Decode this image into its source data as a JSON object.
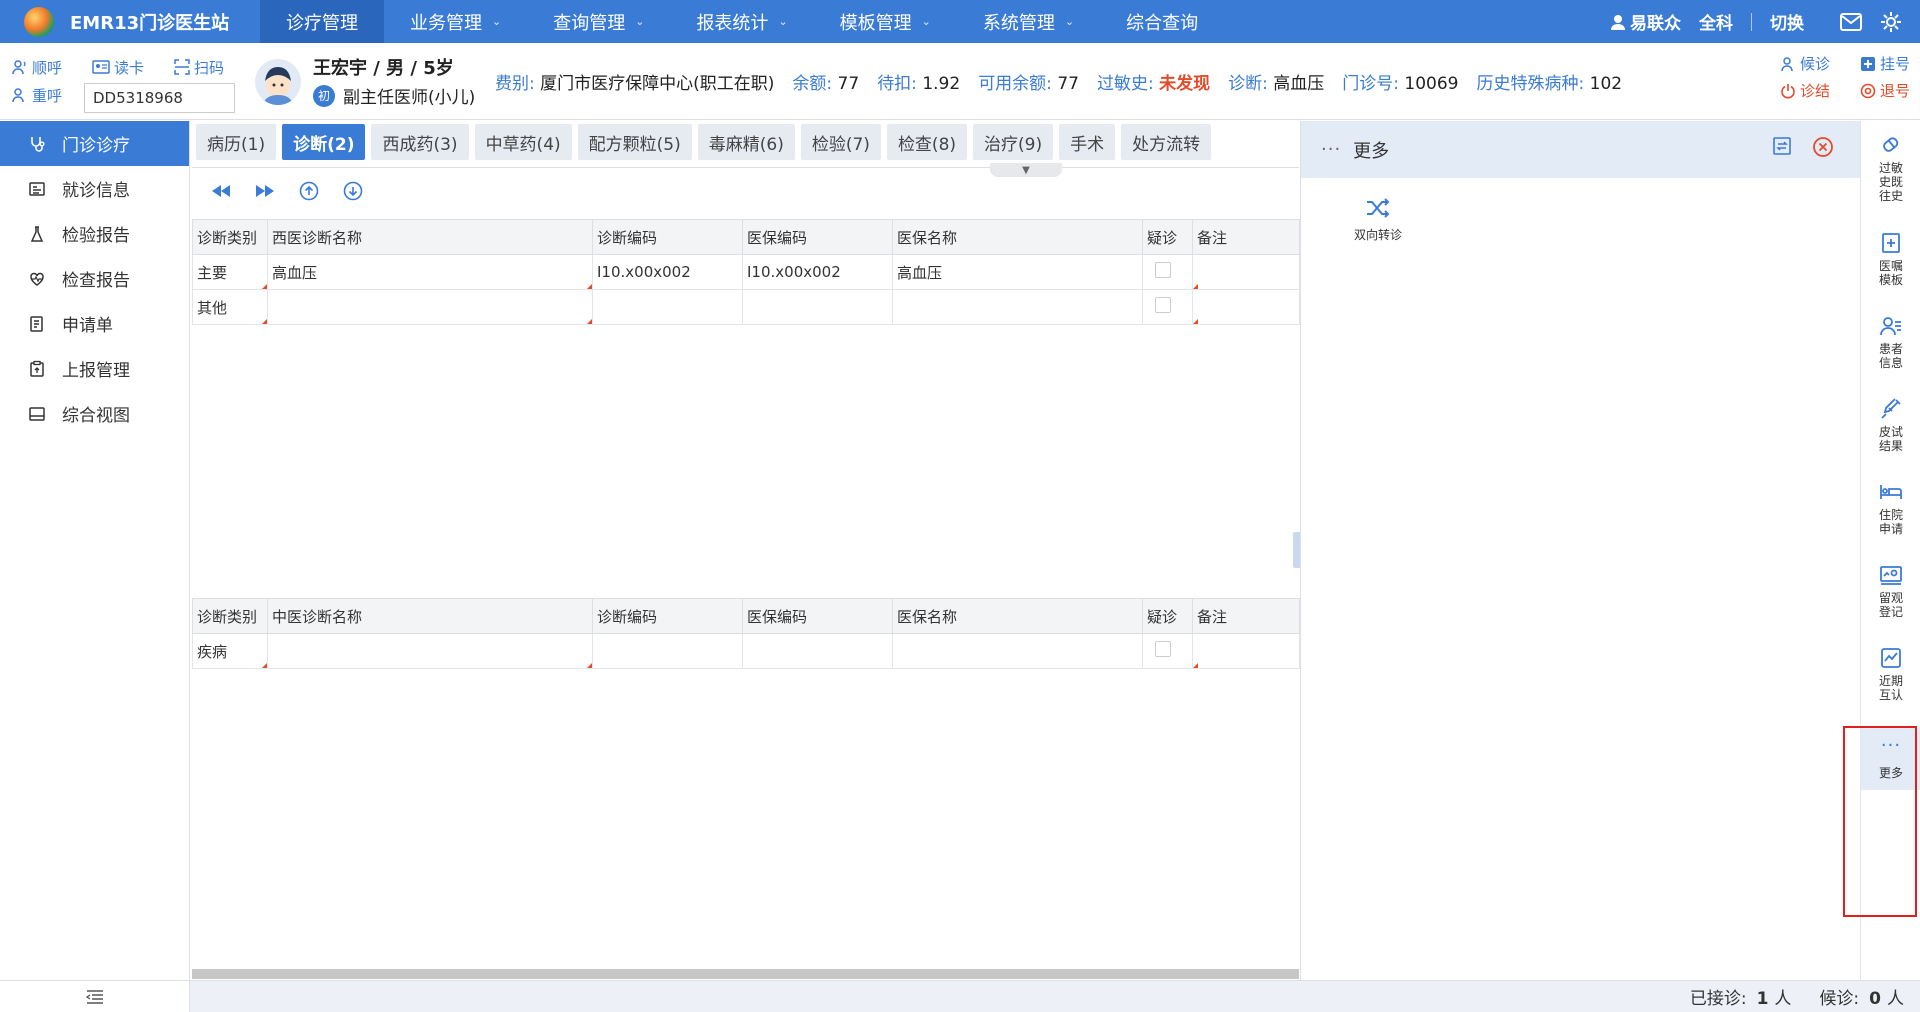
{
  "app": {
    "title": "EMR13门诊医生站"
  },
  "nav": [
    {
      "label": "诊疗管理",
      "active": true,
      "dropdown": false
    },
    {
      "label": "业务管理",
      "active": false,
      "dropdown": true
    },
    {
      "label": "查询管理",
      "active": false,
      "dropdown": true
    },
    {
      "label": "报表统计",
      "active": false,
      "dropdown": true
    },
    {
      "label": "模板管理",
      "active": false,
      "dropdown": true
    },
    {
      "label": "系统管理",
      "active": false,
      "dropdown": true
    },
    {
      "label": "综合查询",
      "active": false,
      "dropdown": false
    }
  ],
  "user": {
    "name": "易联众",
    "dept": "全科",
    "switch_label": "切换"
  },
  "quick_actions": [
    {
      "label": "顺呼",
      "icon": "call-icon"
    },
    {
      "label": "读卡",
      "icon": "card-icon"
    },
    {
      "label": "扫码",
      "icon": "scan-icon"
    },
    {
      "label": "重呼",
      "icon": "recall-icon"
    }
  ],
  "card_number": "DD5318968",
  "patient": {
    "name_line": "王宏宇 / 男 / 5岁",
    "visit_badge": "初",
    "doctor": "副主任医师(小儿)",
    "fields": [
      {
        "label": "费别:",
        "value": "厦门市医疗保障中心(职工在职)",
        "warn": false
      },
      {
        "label": "余额:",
        "value": "77",
        "warn": false
      },
      {
        "label": "待扣:",
        "value": "1.92",
        "warn": false
      },
      {
        "label": "可用余额:",
        "value": "77",
        "warn": false
      },
      {
        "label": "过敏史:",
        "value": "未发现",
        "warn": true
      },
      {
        "label": "诊断:",
        "value": "高血压",
        "warn": false
      },
      {
        "label": "门诊号:",
        "value": "10069",
        "warn": false
      },
      {
        "label": "历史特殊病种:",
        "value": "102",
        "warn": false
      }
    ]
  },
  "right_actions": [
    {
      "label": "候诊",
      "red": false
    },
    {
      "label": "挂号",
      "red": false
    },
    {
      "label": "诊结",
      "red": true
    },
    {
      "label": "退号",
      "red": true
    }
  ],
  "sidebar": [
    {
      "label": "门诊诊疗",
      "active": true,
      "icon": "stethoscope-icon"
    },
    {
      "label": "就诊信息",
      "active": false,
      "icon": "id-card-icon"
    },
    {
      "label": "检验报告",
      "active": false,
      "icon": "flask-icon"
    },
    {
      "label": "检查报告",
      "active": false,
      "icon": "heart-icon"
    },
    {
      "label": "申请单",
      "active": false,
      "icon": "form-icon"
    },
    {
      "label": "上报管理",
      "active": false,
      "icon": "clipboard-icon"
    },
    {
      "label": "综合视图",
      "active": false,
      "icon": "panel-icon"
    }
  ],
  "tabs": [
    {
      "label": "病历(1)",
      "active": false
    },
    {
      "label": "诊断(2)",
      "active": true
    },
    {
      "label": "西成药(3)",
      "active": false
    },
    {
      "label": "中草药(4)",
      "active": false
    },
    {
      "label": "配方颗粒(5)",
      "active": false
    },
    {
      "label": "毒麻精(6)",
      "active": false
    },
    {
      "label": "检验(7)",
      "active": false
    },
    {
      "label": "检查(8)",
      "active": false
    },
    {
      "label": "治疗(9)",
      "active": false
    },
    {
      "label": "手术",
      "active": false
    },
    {
      "label": "处方流转",
      "active": false
    }
  ],
  "western_table": {
    "headers": [
      "诊断类别",
      "西医诊断名称",
      "诊断编码",
      "医保编码",
      "医保名称",
      "疑诊",
      "备注"
    ],
    "rows": [
      [
        "主要",
        "高血压",
        "I10.x00x002",
        "I10.x00x002",
        "高血压",
        "",
        ""
      ],
      [
        "其他",
        "",
        "",
        "",
        "",
        "",
        ""
      ]
    ]
  },
  "chinese_table": {
    "headers": [
      "诊断类别",
      "中医诊断名称",
      "诊断编码",
      "医保编码",
      "医保名称",
      "疑诊",
      "备注"
    ],
    "rows": [
      [
        "疾病",
        "",
        "",
        "",
        "",
        "",
        ""
      ]
    ]
  },
  "right_panel": {
    "title": "更多",
    "tool_label": "双向转诊"
  },
  "right_strip": [
    {
      "label": "过敏史既往史",
      "icon": "eraser-icon"
    },
    {
      "label": "医嘱模板",
      "icon": "order-template-icon"
    },
    {
      "label": "患者信息",
      "icon": "patient-info-icon"
    },
    {
      "label": "皮试结果",
      "icon": "syringe-icon"
    },
    {
      "label": "住院申请",
      "icon": "bed-icon"
    },
    {
      "label": "留观登记",
      "icon": "observation-icon"
    },
    {
      "label": "近期互认",
      "icon": "chart-doc-icon"
    },
    {
      "label": "更多",
      "icon": "more-icon"
    }
  ],
  "status": {
    "received_label": "已接诊:",
    "received_value": "1",
    "waiting_label": "候诊:",
    "waiting_value": "0",
    "unit": "人"
  },
  "colors": {
    "brand": "#3a7bd5",
    "brand_dark": "#2b66bd",
    "warn": "#e44b2a",
    "highlight": "#e0201a"
  }
}
